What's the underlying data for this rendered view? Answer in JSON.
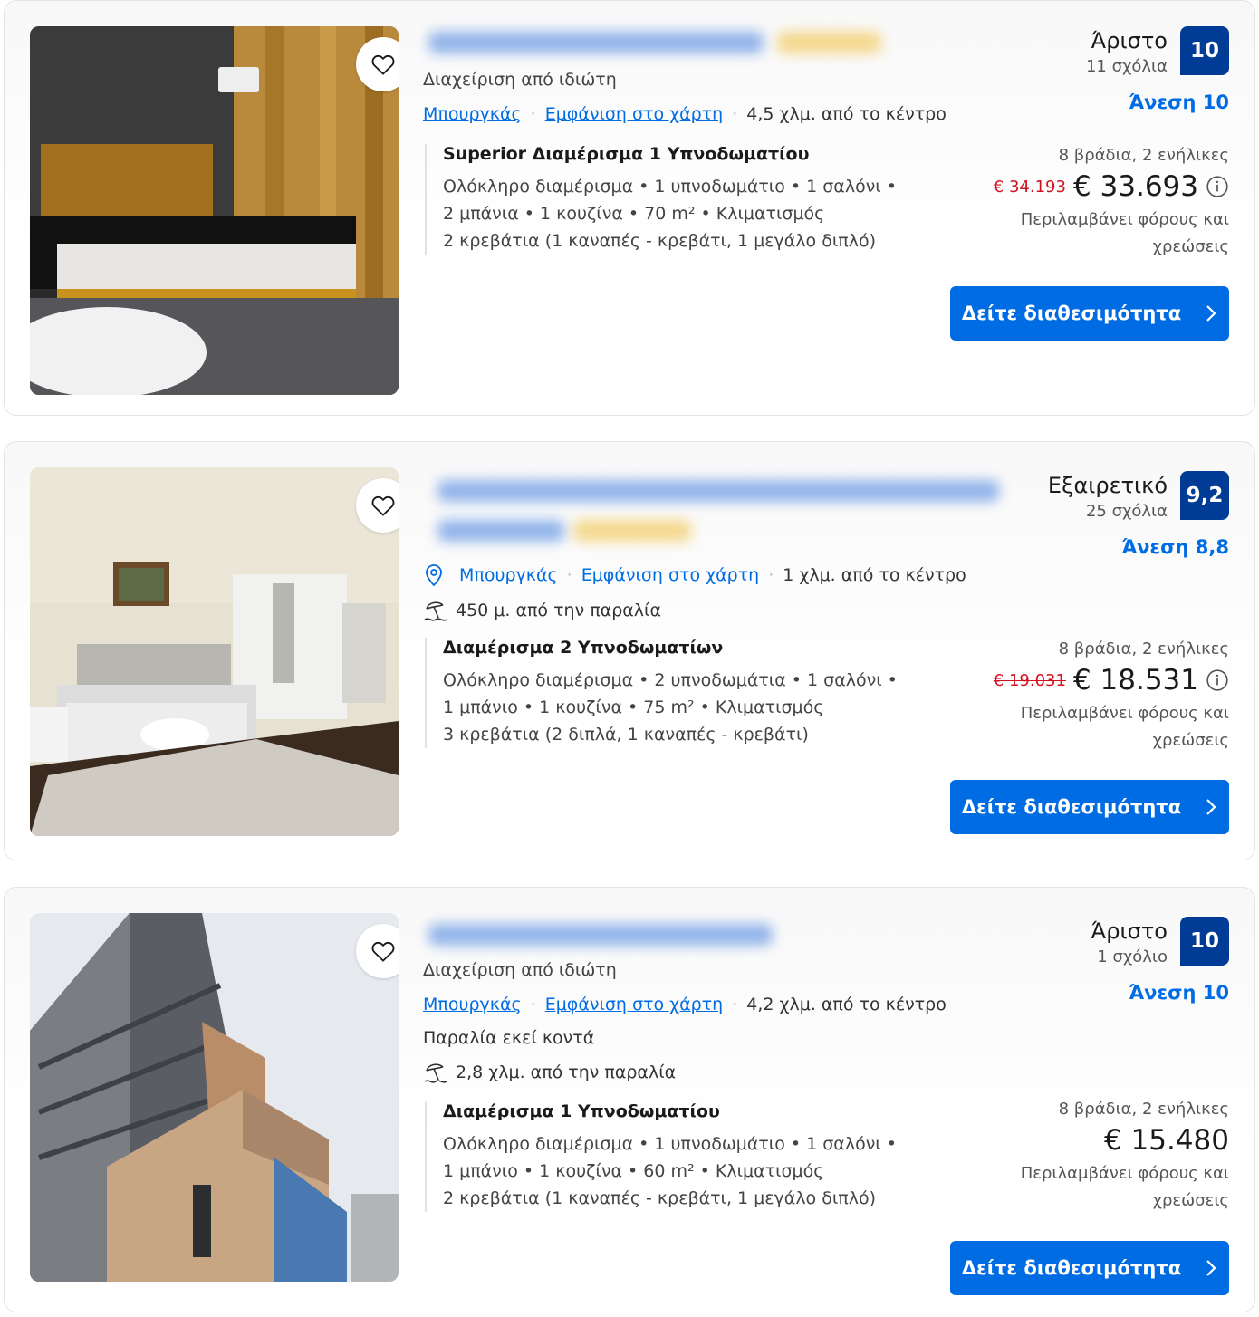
{
  "listings": [
    {
      "managed_by": "Διαχείριση από ιδιώτη",
      "location": "Μπουργκάς",
      "map_link": "Εμφάνιση στο χάρτη",
      "distance": "4,5 χλμ. από το κέντρο",
      "room_name": "Superior Διαμέρισμα 1 Υπνοδωματίου",
      "room_line1": "Ολόκληρο διαμέρισμα • 1 υπνοδωμάτιο • 1 σαλόνι •",
      "room_line2": "2 μπάνια • 1 κουζίνα • 70 m² • Κλιματισμός",
      "room_line3": "2 κρεβάτια (1 καναπές - κρεβάτι, 1 μεγάλο διπλό)",
      "rating_word": "Άριστο",
      "review_count": "11 σχόλια",
      "score": "10",
      "comfort": "Άνεση 10",
      "nights": "8 βράδια, 2 ενήλικες",
      "old_price": "€ 34.193",
      "price": "€ 33.693",
      "taxes_line1": "Περιλαμβάνει φόρους και",
      "taxes_line2": "χρεώσεις",
      "cta": "Δείτε διαθεσιμότητα"
    },
    {
      "location": "Μπουργκάς",
      "map_link": "Εμφάνιση στο χάρτη",
      "distance": "1 χλμ. από το κέντρο",
      "beach": "450 μ. από την παραλία",
      "room_name": "Διαμέρισμα 2 Υπνοδωματίων",
      "room_line1": "Ολόκληρο διαμέρισμα • 2 υπνοδωμάτια • 1 σαλόνι •",
      "room_line2": "1 μπάνιο • 1 κουζίνα • 75 m² • Κλιματισμός",
      "room_line3": "3 κρεβάτια (2 διπλά, 1 καναπές - κρεβάτι)",
      "rating_word": "Εξαιρετικό",
      "review_count": "25 σχόλια",
      "score": "9,2",
      "comfort": "Άνεση 8,8",
      "nights": "8 βράδια, 2 ενήλικες",
      "old_price": "€ 19.031",
      "price": "€ 18.531",
      "taxes_line1": "Περιλαμβάνει φόρους και",
      "taxes_line2": "χρεώσεις",
      "cta": "Δείτε διαθεσιμότητα"
    },
    {
      "managed_by": "Διαχείριση από ιδιώτη",
      "location": "Μπουργκάς",
      "map_link": "Εμφάνιση στο χάρτη",
      "distance": "4,2 χλμ. από το κέντρο",
      "beach_nearby": "Παραλία εκεί κοντά",
      "beach": "2,8 χλμ. από την παραλία",
      "room_name": "Διαμέρισμα 1 Υπνοδωματίου",
      "room_line1": "Ολόκληρο διαμέρισμα • 1 υπνοδωμάτιο • 1 σαλόνι •",
      "room_line2": "1 μπάνιο • 1 κουζίνα • 60 m² • Κλιματισμός",
      "room_line3": "2 κρεβάτια (1 καναπές - κρεβάτι, 1 μεγάλο διπλό)",
      "rating_word": "Άριστο",
      "review_count": "1 σχόλιο",
      "score": "10",
      "comfort": "Άνεση 10",
      "nights": "8 βράδια, 2 ενήλικες",
      "price": "€ 15.480",
      "taxes_line1": "Περιλαμβάνει φόρους και",
      "taxes_line2": "χρεώσεις",
      "cta": "Δείτε διαθεσιμότητα"
    }
  ],
  "colors": {
    "link": "#006ce4",
    "score_bg": "#003b95",
    "strike_price": "#d4111e",
    "cta_bg": "#006ce4"
  },
  "icons": [
    "heart-icon",
    "map-pin-icon",
    "beach-icon",
    "info-icon",
    "chevron-right-icon"
  ]
}
